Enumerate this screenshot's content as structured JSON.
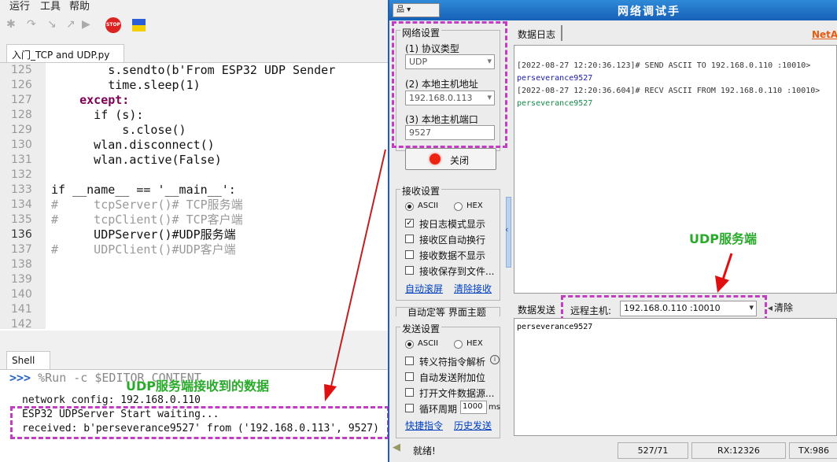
{
  "ide": {
    "menu": [
      "运行",
      "工具",
      "帮助"
    ],
    "file_tab": "入门_TCP and UDP.py",
    "tab_close": "×",
    "line_numbers": [
      "125",
      "126",
      "127",
      "128",
      "129",
      "130",
      "131",
      "132",
      "133",
      "134",
      "135",
      "136",
      "137",
      "138",
      "139",
      "140",
      "141",
      "142"
    ],
    "code_lines": [
      "        s.sendto(b'From ESP32 UDP Sender",
      "        time.sleep(1)",
      "    except:",
      "      if (s):",
      "          s.close()",
      "      wlan.disconnect()",
      "      wlan.active(False)",
      "",
      "if __name__ == '__main__':",
      "#     tcpServer()# TCP服务端",
      "#     tcpClient()# TCP客户端",
      "      UDPServer()#UDP服务端",
      "#     UDPClient()#UDP客户端"
    ],
    "shell_tab": "Shell",
    "shell_prompt": ">>>",
    "shell_command": " %Run -c $EDITOR_CONTENT",
    "shell_lines": [
      "network config: 192.168.0.110",
      "ESP32 UDPServer Start waiting...",
      "received: b'perseverance9527' from ('192.168.0.113', 9527)"
    ]
  },
  "assistant": {
    "title": "网络调试手",
    "brand": "NetAs",
    "net_settings_label": "网络设置",
    "protocol_label": "(1) 协议类型",
    "protocol_value": "UDP",
    "local_host_label": "(2) 本地主机地址",
    "local_host_value": "192.168.0.113",
    "local_port_label": "(3) 本地主机端口",
    "local_port_value": "9527",
    "close_button": "关闭",
    "recv_settings_label": "接收设置",
    "recv_ascii": "ASCII",
    "recv_hex": "HEX",
    "recv_options": [
      "按日志模式显示",
      "接收区自动换行",
      "接收数据不显示",
      "接收保存到文件..."
    ],
    "recv_options_checked": [
      true,
      false,
      false,
      false
    ],
    "auto_scroll": "自动滚屏",
    "clear_recv": "清除接收",
    "partial_text": "自动定等 界面主题",
    "send_settings_label": "发送设置",
    "send_ascii": "ASCII",
    "send_hex": "HEX",
    "send_options": [
      "转义符指令解析",
      "自动发送附加位",
      "打开文件数据源...",
      "循环周期"
    ],
    "cycle_value": "1000",
    "cycle_unit": "ms",
    "shortcut": "快捷指令",
    "history": "历史发送",
    "log_tab": "数据日志",
    "log_lines": [
      {
        "text": "[2022-08-27 12:20:36.123]# SEND ASCII TO 192.168.0.110 :10010>",
        "color": "#333333"
      },
      {
        "text": "perseverance9527",
        "color": "#1a1aa8"
      },
      {
        "text": "[2022-08-27 12:20:36.604]# RECV ASCII FROM 192.168.0.110 :10010>",
        "color": "#333333"
      },
      {
        "text": "perseverance9527",
        "color": "#16884a"
      }
    ],
    "send_tab": "数据发送",
    "remote_label": "远程主机:",
    "remote_value": "192.168.0.110 :10010",
    "clear_button": "清除",
    "send_text": "perseverance9527",
    "status_ready": "就绪!",
    "status_count": "527/71",
    "status_rx": "RX:12326",
    "status_tx": "TX:986"
  },
  "annotations": {
    "udp_server": "UDP服务端",
    "received": "UDP服务端接收到的数据"
  },
  "colors": {
    "highlight": "#c23dc2",
    "arrow": "#e01010",
    "annotation": "#2aaa2a",
    "title_bar": "#1f6fc4"
  }
}
